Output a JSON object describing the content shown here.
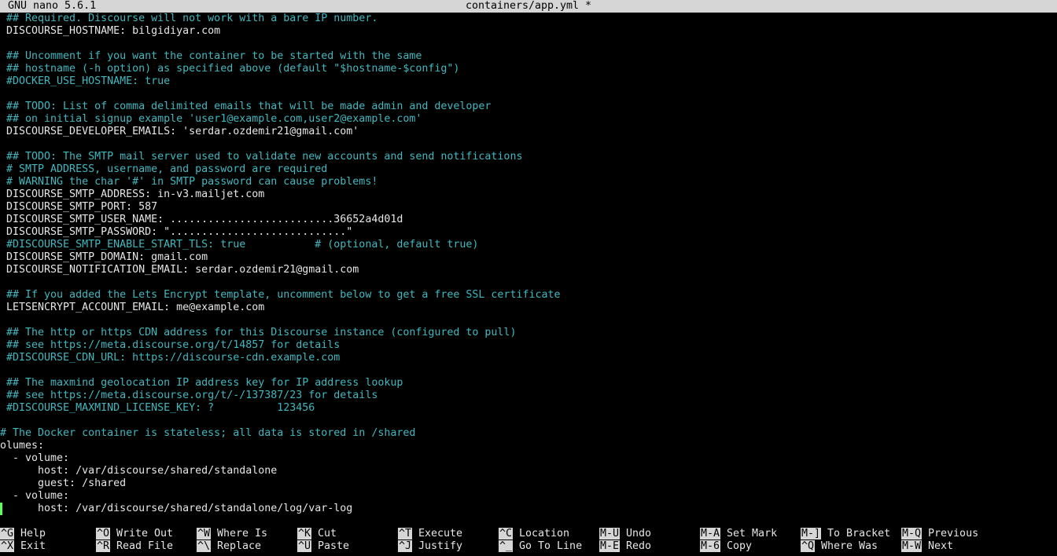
{
  "titlebar": {
    "app": "GNU nano 5.6.1",
    "filename": "containers/app.yml *"
  },
  "editor": {
    "lines": [
      {
        "kind": "c",
        "text": " ## Required. Discourse will not work with a bare IP number."
      },
      {
        "kind": "k",
        "text": " DISCOURSE_HOSTNAME: bilgidiyar.com"
      },
      {
        "kind": "k",
        "text": ""
      },
      {
        "kind": "c",
        "text": " ## Uncomment if you want the container to be started with the same"
      },
      {
        "kind": "c",
        "text": " ## hostname (-h option) as specified above (default \"$hostname-$config\")"
      },
      {
        "kind": "c",
        "text": " #DOCKER_USE_HOSTNAME: true"
      },
      {
        "kind": "k",
        "text": ""
      },
      {
        "kind": "c",
        "text": " ## TODO: List of comma delimited emails that will be made admin and developer"
      },
      {
        "kind": "c",
        "text": " ## on initial signup example 'user1@example.com,user2@example.com'"
      },
      {
        "kind": "k",
        "text": " DISCOURSE_DEVELOPER_EMAILS: 'serdar.ozdemir21@gmail.com'"
      },
      {
        "kind": "k",
        "text": ""
      },
      {
        "kind": "c",
        "text": " ## TODO: The SMTP mail server used to validate new accounts and send notifications"
      },
      {
        "kind": "c",
        "text": " # SMTP ADDRESS, username, and password are required"
      },
      {
        "kind": "c",
        "text": " # WARNING the char '#' in SMTP password can cause problems!"
      },
      {
        "kind": "k",
        "text": " DISCOURSE_SMTP_ADDRESS: in-v3.mailjet.com"
      },
      {
        "kind": "k",
        "text": " DISCOURSE_SMTP_PORT: 587"
      },
      {
        "kind": "k",
        "text": " DISCOURSE_SMTP_USER_NAME: ..........................36652a4d01d"
      },
      {
        "kind": "k",
        "text": " DISCOURSE_SMTP_PASSWORD: \"............................\""
      },
      {
        "kind": "c",
        "text": " #DISCOURSE_SMTP_ENABLE_START_TLS: true           # (optional, default true)"
      },
      {
        "kind": "k",
        "text": " DISCOURSE_SMTP_DOMAIN: gmail.com"
      },
      {
        "kind": "k",
        "text": " DISCOURSE_NOTIFICATION_EMAIL: serdar.ozdemir21@gmail.com"
      },
      {
        "kind": "k",
        "text": ""
      },
      {
        "kind": "c",
        "text": " ## If you added the Lets Encrypt template, uncomment below to get a free SSL certificate"
      },
      {
        "kind": "k",
        "text": " LETSENCRYPT_ACCOUNT_EMAIL: me@example.com"
      },
      {
        "kind": "k",
        "text": ""
      },
      {
        "kind": "c",
        "text": " ## The http or https CDN address for this Discourse instance (configured to pull)"
      },
      {
        "kind": "c",
        "text": " ## see https://meta.discourse.org/t/14857 for details"
      },
      {
        "kind": "c",
        "text": " #DISCOURSE_CDN_URL: https://discourse-cdn.example.com"
      },
      {
        "kind": "k",
        "text": ""
      },
      {
        "kind": "c",
        "text": " ## The maxmind geolocation IP address key for IP address lookup"
      },
      {
        "kind": "c",
        "text": " ## see https://meta.discourse.org/t/-/137387/23 for details"
      },
      {
        "kind": "c",
        "text": " #DISCOURSE_MAXMIND_LICENSE_KEY: ?          123456"
      },
      {
        "kind": "k",
        "text": ""
      },
      {
        "kind": "c",
        "text": "# The Docker container is stateless; all data is stored in /shared"
      },
      {
        "kind": "k",
        "text": "olumes:"
      },
      {
        "kind": "k",
        "text": "  - volume:"
      },
      {
        "kind": "k",
        "text": "      host: /var/discourse/shared/standalone"
      },
      {
        "kind": "k",
        "text": "      guest: /shared"
      },
      {
        "kind": "k",
        "text": "  - volume:"
      },
      {
        "kind": "k",
        "text": "      host: /var/discourse/shared/standalone/log/var-log"
      }
    ]
  },
  "shortcuts": [
    {
      "key": "^G",
      "label": "Help",
      "col": 0,
      "row": 0
    },
    {
      "key": "^X",
      "label": "Exit",
      "col": 0,
      "row": 1
    },
    {
      "key": "^O",
      "label": "Write Out",
      "col": 1,
      "row": 0
    },
    {
      "key": "^R",
      "label": "Read File",
      "col": 1,
      "row": 1
    },
    {
      "key": "^W",
      "label": "Where Is",
      "col": 2,
      "row": 0
    },
    {
      "key": "^\\",
      "label": "Replace",
      "col": 2,
      "row": 1
    },
    {
      "key": "^K",
      "label": "Cut",
      "col": 3,
      "row": 0
    },
    {
      "key": "^U",
      "label": "Paste",
      "col": 3,
      "row": 1
    },
    {
      "key": "^T",
      "label": "Execute",
      "col": 4,
      "row": 0
    },
    {
      "key": "^J",
      "label": "Justify",
      "col": 4,
      "row": 1
    },
    {
      "key": "^C",
      "label": "Location",
      "col": 5,
      "row": 0
    },
    {
      "key": "^_",
      "label": "Go To Line",
      "col": 5,
      "row": 1
    },
    {
      "key": "M-U",
      "label": "Undo",
      "col": 6,
      "row": 0
    },
    {
      "key": "M-E",
      "label": "Redo",
      "col": 6,
      "row": 1
    },
    {
      "key": "M-A",
      "label": "Set Mark",
      "col": 7,
      "row": 0
    },
    {
      "key": "M-6",
      "label": "Copy",
      "col": 7,
      "row": 1
    },
    {
      "key": "M-]",
      "label": "To Bracket",
      "col": 8,
      "row": 0
    },
    {
      "key": "^Q",
      "label": "Where Was",
      "col": 8,
      "row": 1
    },
    {
      "key": "M-Q",
      "label": "Previous",
      "col": 9,
      "row": 0
    },
    {
      "key": "M-W",
      "label": "Next",
      "col": 9,
      "row": 1
    }
  ],
  "colors": {
    "background": "#000000",
    "comment": "#3fb8c0",
    "text": "#e6e6e6",
    "titlebar_bg": "#d6d6d6",
    "cursor": "#5cff5c"
  }
}
